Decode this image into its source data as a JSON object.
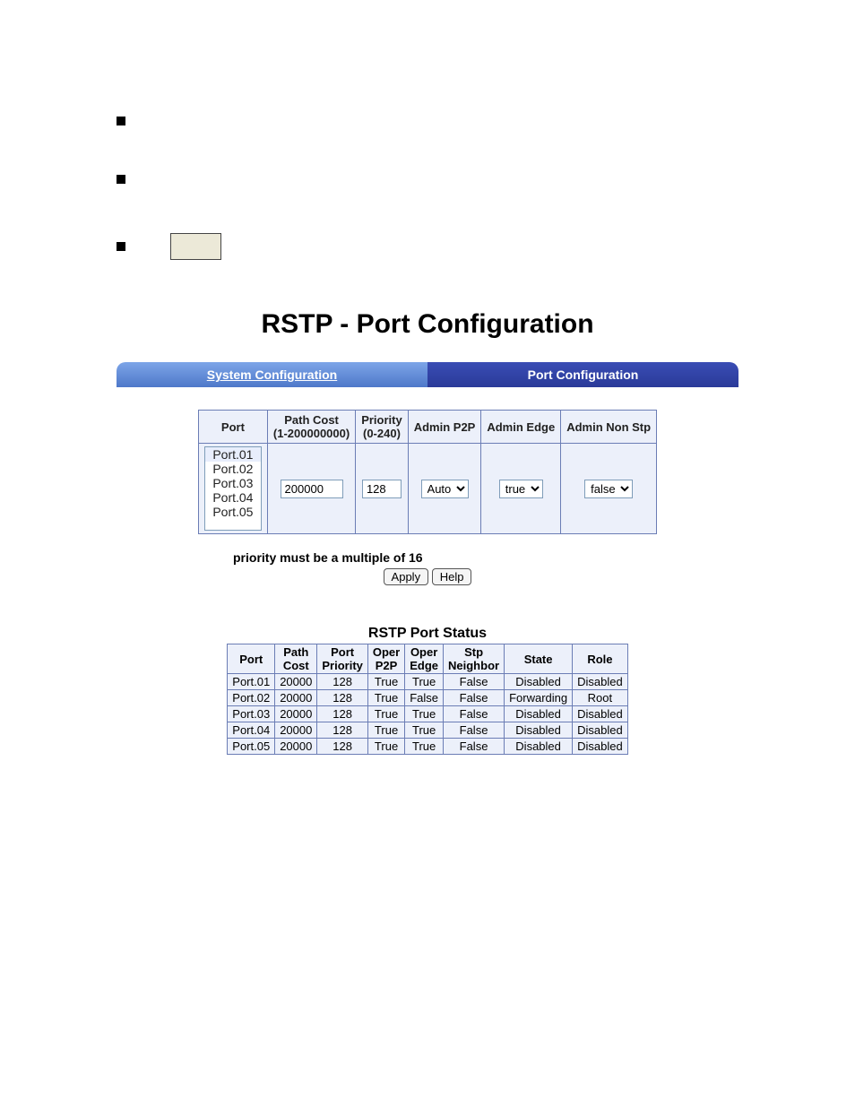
{
  "page_title": "RSTP - Port Configuration",
  "tabs": {
    "left": "System Configuration",
    "right": "Port Configuration"
  },
  "config": {
    "headers": {
      "port": "Port",
      "path_cost_line1": "Path Cost",
      "path_cost_line2": "(1-200000000)",
      "priority_line1": "Priority",
      "priority_line2": "(0-240)",
      "admin_p2p": "Admin P2P",
      "admin_edge": "Admin Edge",
      "admin_non_stp": "Admin Non Stp"
    },
    "ports": [
      "Port.01",
      "Port.02",
      "Port.03",
      "Port.04",
      "Port.05"
    ],
    "path_cost_value": "200000",
    "priority_value": "128",
    "admin_p2p_value": "Auto",
    "admin_edge_value": "true",
    "admin_non_stp_value": "false"
  },
  "note": "priority must be a multiple of 16",
  "buttons": {
    "apply": "Apply",
    "help": "Help"
  },
  "status": {
    "title": "RSTP Port Status",
    "headers": {
      "port": "Port",
      "path_cost_l1": "Path",
      "path_cost_l2": "Cost",
      "port_priority_l1": "Port",
      "port_priority_l2": "Priority",
      "oper_p2p_l1": "Oper",
      "oper_p2p_l2": "P2P",
      "oper_edge_l1": "Oper",
      "oper_edge_l2": "Edge",
      "stp_neighbor_l1": "Stp",
      "stp_neighbor_l2": "Neighbor",
      "state": "State",
      "role": "Role"
    },
    "rows": [
      {
        "port": "Port.01",
        "path_cost": "20000",
        "priority": "128",
        "oper_p2p": "True",
        "oper_edge": "True",
        "stp_neighbor": "False",
        "state": "Disabled",
        "role": "Disabled"
      },
      {
        "port": "Port.02",
        "path_cost": "20000",
        "priority": "128",
        "oper_p2p": "True",
        "oper_edge": "False",
        "stp_neighbor": "False",
        "state": "Forwarding",
        "role": "Root"
      },
      {
        "port": "Port.03",
        "path_cost": "20000",
        "priority": "128",
        "oper_p2p": "True",
        "oper_edge": "True",
        "stp_neighbor": "False",
        "state": "Disabled",
        "role": "Disabled"
      },
      {
        "port": "Port.04",
        "path_cost": "20000",
        "priority": "128",
        "oper_p2p": "True",
        "oper_edge": "True",
        "stp_neighbor": "False",
        "state": "Disabled",
        "role": "Disabled"
      },
      {
        "port": "Port.05",
        "path_cost": "20000",
        "priority": "128",
        "oper_p2p": "True",
        "oper_edge": "True",
        "stp_neighbor": "False",
        "state": "Disabled",
        "role": "Disabled"
      }
    ]
  }
}
